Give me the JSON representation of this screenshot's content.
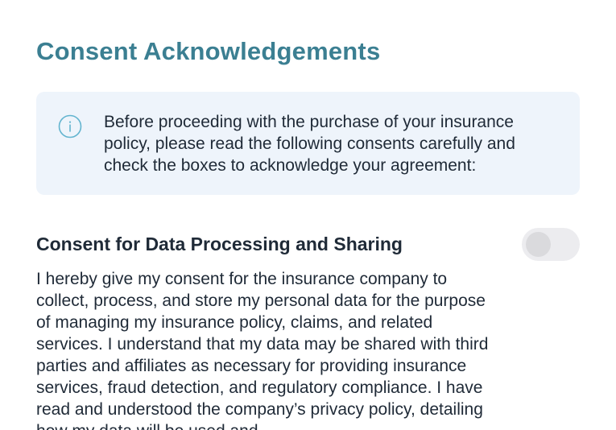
{
  "page": {
    "title": "Consent Acknowledgements"
  },
  "info": {
    "icon": "info-icon",
    "text": "Before proceeding with the purchase of your insurance policy, please read the following consents carefully and check the boxes to acknowledge your agreement:"
  },
  "consent": {
    "heading": "Consent for Data Processing and Sharing",
    "toggle_checked": false,
    "body": "I hereby give my consent for the insurance company to collect, process, and store my personal data for the purpose of managing my insurance policy, claims, and related services. I understand that my data may be shared with third parties and affiliates as necessary for providing insurance services, fraud detection, and regulatory compliance. I have read and understood the company’s privacy policy, detailing how my data will be used and"
  },
  "colors": {
    "title": "#3b7f92",
    "info_background": "#eef4fb",
    "info_icon": "#62b4cf",
    "body_text": "#1f2a37",
    "toggle_track": "#ececef",
    "toggle_knob": "#dadadd"
  }
}
